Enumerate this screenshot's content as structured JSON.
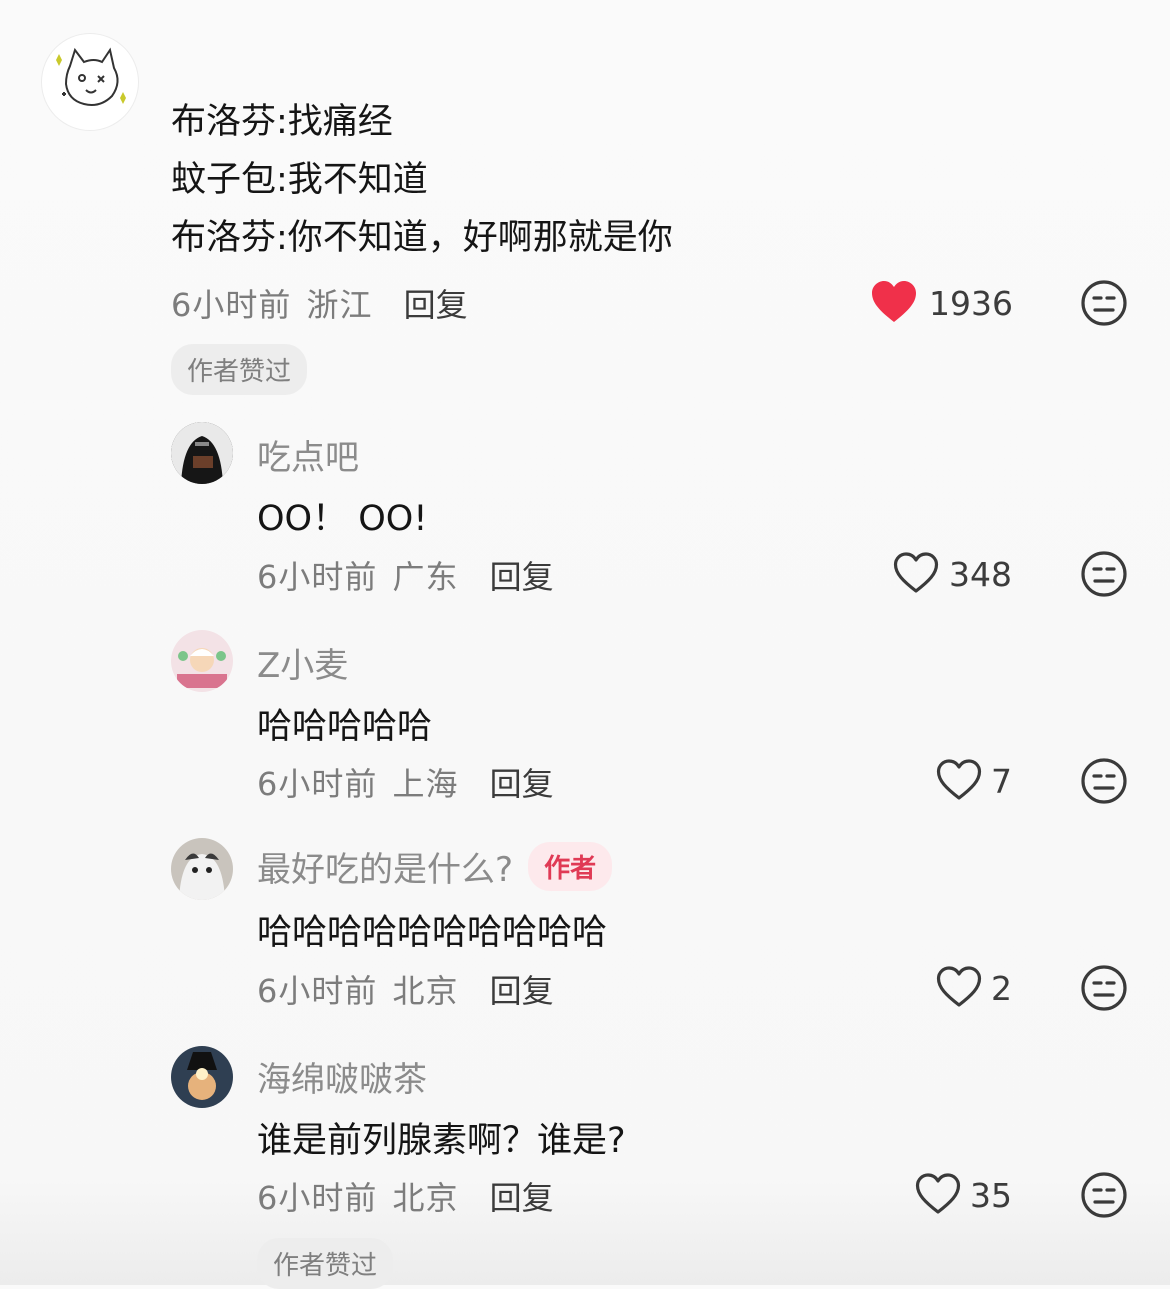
{
  "root": {
    "lines": [
      "布洛芬:找痛经",
      "蚊子包:我不知道",
      "布洛芬:你不知道，好啊那就是你"
    ],
    "time": "6小时前",
    "location": "浙江",
    "reply_label": "回复",
    "likes": "1936",
    "liked": true,
    "badge": "作者赞过"
  },
  "replies": [
    {
      "name": "吃点吧",
      "text": "OO！ OO!",
      "time": "6小时前",
      "location": "广东",
      "reply_label": "回复",
      "likes": "348"
    },
    {
      "name": "Z小麦",
      "text": "哈哈哈哈哈",
      "time": "6小时前",
      "location": "上海",
      "reply_label": "回复",
      "likes": "7"
    },
    {
      "name": "最好吃的是什么?",
      "author_tag": "作者",
      "text": "哈哈哈哈哈哈哈哈哈哈",
      "time": "6小时前",
      "location": "北京",
      "reply_label": "回复",
      "likes": "2"
    },
    {
      "name": "海绵啵啵茶",
      "text": "谁是前列腺素啊？谁是?",
      "time": "6小时前",
      "location": "北京",
      "reply_label": "回复",
      "likes": "35",
      "badge": "作者赞过"
    }
  ],
  "icons": {
    "like": "heart-icon",
    "liked_color": "#f0304a",
    "outline_color": "#3a3a3a",
    "more": "face-neutral-icon"
  }
}
